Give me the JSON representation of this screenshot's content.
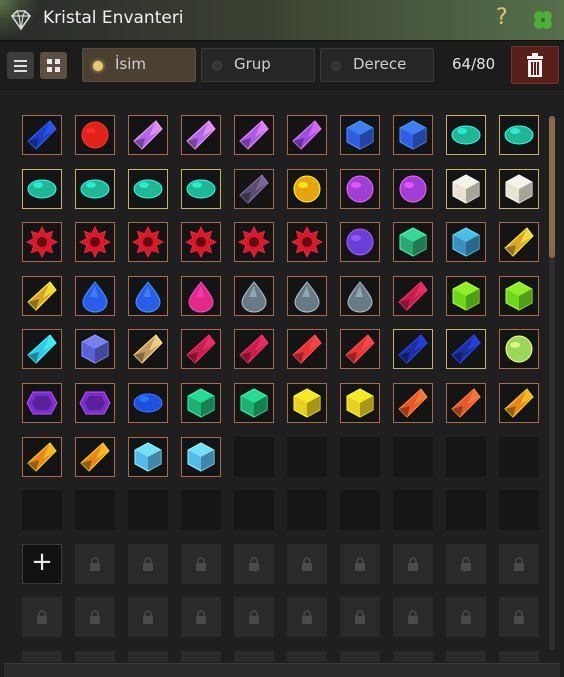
{
  "window": {
    "title": "Kristal Envanteri"
  },
  "toolbar": {
    "sort_options": [
      {
        "label": "İsim",
        "active": true
      },
      {
        "label": "Grup",
        "active": false
      },
      {
        "label": "Derece",
        "active": false
      }
    ],
    "capacity": "64/80"
  },
  "icons": {
    "app": "diamond-icon",
    "help": "question-icon",
    "clover": "clover-icon",
    "list_view": "list-view-icon",
    "grid_view": "grid-view-icon",
    "delete": "trash-icon",
    "add_slot": "plus-icon",
    "locked": "lock-icon"
  },
  "add_slot_symbol": "+",
  "help_symbol": "?",
  "colors": {
    "accent_gold": "#e8c874",
    "item_border": "#a86b4a",
    "delete_bg": "#57201b",
    "clover": "#4fae3b"
  },
  "inventory": {
    "items": [
      {
        "gem": "sapphire-shard",
        "color": "#1e40c8"
      },
      {
        "gem": "ruby-round",
        "color": "#e0221a"
      },
      {
        "gem": "amethyst-shard",
        "color": "#b067e8"
      },
      {
        "gem": "amethyst-shard",
        "color": "#b067e8"
      },
      {
        "gem": "amethyst-shard",
        "color": "#a95be6"
      },
      {
        "gem": "amethyst-shard",
        "color": "#9a4ee0"
      },
      {
        "gem": "sapphire-crystal",
        "color": "#2f5fe0"
      },
      {
        "gem": "sapphire-crystal",
        "color": "#2f5fe0"
      },
      {
        "gem": "emerald-oval",
        "color": "#20b894"
      },
      {
        "gem": "emerald-oval",
        "color": "#20b894"
      },
      {
        "gem": "emerald-oval",
        "color": "#20b894"
      },
      {
        "gem": "emerald-oval",
        "color": "#20b894"
      },
      {
        "gem": "emerald-oval",
        "color": "#20b894"
      },
      {
        "gem": "emerald-oval",
        "color": "#20b894"
      },
      {
        "gem": "obsidian-shard",
        "color": "#5a4a6e"
      },
      {
        "gem": "topaz-round",
        "color": "#e5a410"
      },
      {
        "gem": "amethyst-round",
        "color": "#9f3fd8"
      },
      {
        "gem": "amethyst-round",
        "color": "#9f3fd8"
      },
      {
        "gem": "diamond-cube",
        "color": "#e8e2d0"
      },
      {
        "gem": "diamond-cube",
        "color": "#e8e2d0"
      },
      {
        "gem": "ruby-star",
        "color": "#d8192a"
      },
      {
        "gem": "ruby-star",
        "color": "#d8192a"
      },
      {
        "gem": "ruby-star",
        "color": "#d8192a"
      },
      {
        "gem": "ruby-star",
        "color": "#d8192a"
      },
      {
        "gem": "ruby-star",
        "color": "#d8192a"
      },
      {
        "gem": "ruby-star",
        "color": "#d8192a"
      },
      {
        "gem": "amethyst-round",
        "color": "#6c3ed8"
      },
      {
        "gem": "tourmaline-cube",
        "color": "#2aa870"
      },
      {
        "gem": "tourmaline-cube",
        "color": "#3a8fc0"
      },
      {
        "gem": "topaz-shard",
        "color": "#d9a62a"
      },
      {
        "gem": "topaz-shard",
        "color": "#d9a62a"
      },
      {
        "gem": "sapphire-tri",
        "color": "#2a5ee8"
      },
      {
        "gem": "sapphire-tri",
        "color": "#2a5ee8"
      },
      {
        "gem": "rhodolite-drop",
        "color": "#e02a86"
      },
      {
        "gem": "onyx-drop",
        "color": "#6a7a84"
      },
      {
        "gem": "onyx-drop",
        "color": "#6a7a84"
      },
      {
        "gem": "onyx-drop",
        "color": "#6a7a84"
      },
      {
        "gem": "garnet-shard",
        "color": "#c81f4a"
      },
      {
        "gem": "peridot-crystal",
        "color": "#6ed81f"
      },
      {
        "gem": "peridot-crystal",
        "color": "#6ed81f"
      },
      {
        "gem": "aquamarine-shard",
        "color": "#2ec8e8"
      },
      {
        "gem": "tanzanite-cube",
        "color": "#5a60d8"
      },
      {
        "gem": "smoky-quartz",
        "color": "#c89660"
      },
      {
        "gem": "garnet-shard",
        "color": "#c81f4a"
      },
      {
        "gem": "garnet-shard",
        "color": "#c81f4a"
      },
      {
        "gem": "ruby-shard",
        "color": "#e83434"
      },
      {
        "gem": "ruby-shard",
        "color": "#e83434"
      },
      {
        "gem": "sapphire-dark",
        "color": "#1a2fa0"
      },
      {
        "gem": "sapphire-dark",
        "color": "#1a2fa0"
      },
      {
        "gem": "peridot-round",
        "color": "#9cd858"
      },
      {
        "gem": "amethyst-hex",
        "color": "#7a2ed0"
      },
      {
        "gem": "amethyst-hex",
        "color": "#7a2ed0"
      },
      {
        "gem": "sapphire-oval",
        "color": "#2050e0"
      },
      {
        "gem": "emerald-square",
        "color": "#1eb070"
      },
      {
        "gem": "emerald-square",
        "color": "#1eb070"
      },
      {
        "gem": "citrine-crystal",
        "color": "#e8d020"
      },
      {
        "gem": "citrine-crystal",
        "color": "#e8d020"
      },
      {
        "gem": "fire-opal",
        "color": "#e8582a"
      },
      {
        "gem": "fire-opal",
        "color": "#e8582a"
      },
      {
        "gem": "amber-shard",
        "color": "#e8881a"
      },
      {
        "gem": "amber-shard",
        "color": "#e8881a"
      },
      {
        "gem": "amber-shard",
        "color": "#e8881a"
      },
      {
        "gem": "aquamarine-cube",
        "color": "#58b8e8"
      },
      {
        "gem": "aquamarine-cube",
        "color": "#58b8e8"
      }
    ],
    "total_slots": 80
  }
}
